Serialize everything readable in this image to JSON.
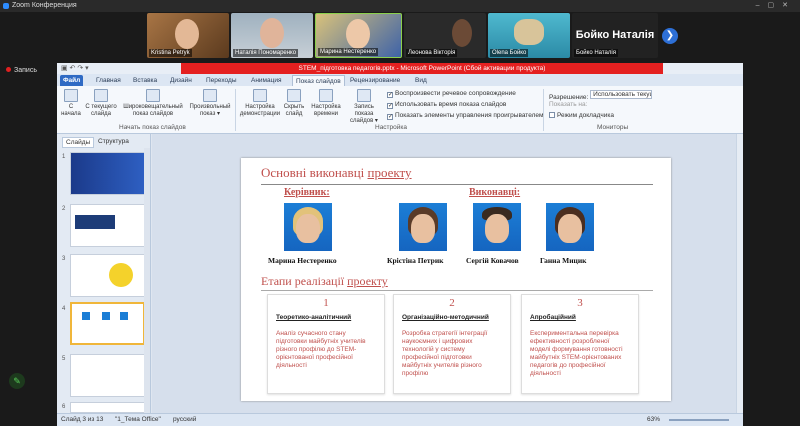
{
  "zoom": {
    "window_title": "Zoom Конференция",
    "recording_label": "Запись",
    "next_arrow": "❯",
    "participants": [
      {
        "name": "Kristina Petryk"
      },
      {
        "name": "Наталія Пономаренко"
      },
      {
        "name": "Марина Нестеренко"
      },
      {
        "name": "Леонова Вікторія"
      },
      {
        "name": "Olena Бойко"
      }
    ],
    "speaker": {
      "big_name": "Бойко Наталія",
      "small_name": "Бойко Наталія"
    }
  },
  "ppt": {
    "title_bar": "STEM_підготовка педагогів.pptx - Microsoft PowerPoint (Сбой активации продукта)",
    "tabs": [
      "Файл",
      "Главная",
      "Вставка",
      "Дизайн",
      "Переходы",
      "Анимация",
      "Показ слайдов",
      "Рецензирование",
      "Вид"
    ],
    "ribbon": {
      "btn_from_start": "С начала",
      "btn_from_current": "С текущего слайда",
      "btn_broadcast": "Широковещательный показ слайдов",
      "btn_custom": "Произвольный показ ▾",
      "group_start": "Начать показ слайдов",
      "btn_setup": "Настройка демонстрации",
      "btn_hide": "Скрыть слайд",
      "btn_timings": "Настройка времени",
      "btn_record": "Запись показа слайдов ▾",
      "chk_narration": "Воспроизвести речевое сопровождение",
      "chk_timings": "Использовать время показа слайдов",
      "chk_controls": "Показать элементы управления проигрывателем",
      "group_setup": "Настройка",
      "resolution_label": "Разрешение:",
      "resolution_value": "Использовать текуще...",
      "show_on_label": "Показать на:",
      "presenter_view": "Режим докладчика",
      "group_monitors": "Мониторы"
    },
    "panel_tabs": [
      "Слайды",
      "Структура"
    ],
    "thumb_numbers": [
      "1",
      "2",
      "3",
      "4",
      "5",
      "6"
    ],
    "slide": {
      "title_plain": "Основні виконавці ",
      "title_underlined": "проекту",
      "leader_head": "Керівник:",
      "team_head": "Виконавці:",
      "people": [
        {
          "name": "Марина Нестеренко"
        },
        {
          "name": "Крістіна Петрик"
        },
        {
          "name": "Сергій Ковачов"
        },
        {
          "name": "Ганна Мицик"
        }
      ],
      "sub_plain": "Етапи реалізації ",
      "sub_underlined": "проекту",
      "stages": [
        {
          "num": "1",
          "title": "Теоретико-аналітичний",
          "desc": "Аналіз сучасного стану підготовки майбутніх учителів різного профілю до STEM-орієнтованої професійної діяльності"
        },
        {
          "num": "2",
          "title": "Організаційно-методичний",
          "desc": "Розробка стратегії інтеграції наукоємних і цифрових технологій у систему професійної підготовки майбутніх учителів різного профілю"
        },
        {
          "num": "3",
          "title": "Апробаційний",
          "desc": "Експериментальна перевірка ефективності розробленої моделі формування готовності майбутніх STEM-орієнтованих педагогів до професійної діяльності"
        }
      ]
    },
    "status": {
      "slide_of": "Слайд 3 из 13",
      "theme": "\"1_Тема Office\"",
      "lang": "русский",
      "zoom": "63%"
    }
  }
}
